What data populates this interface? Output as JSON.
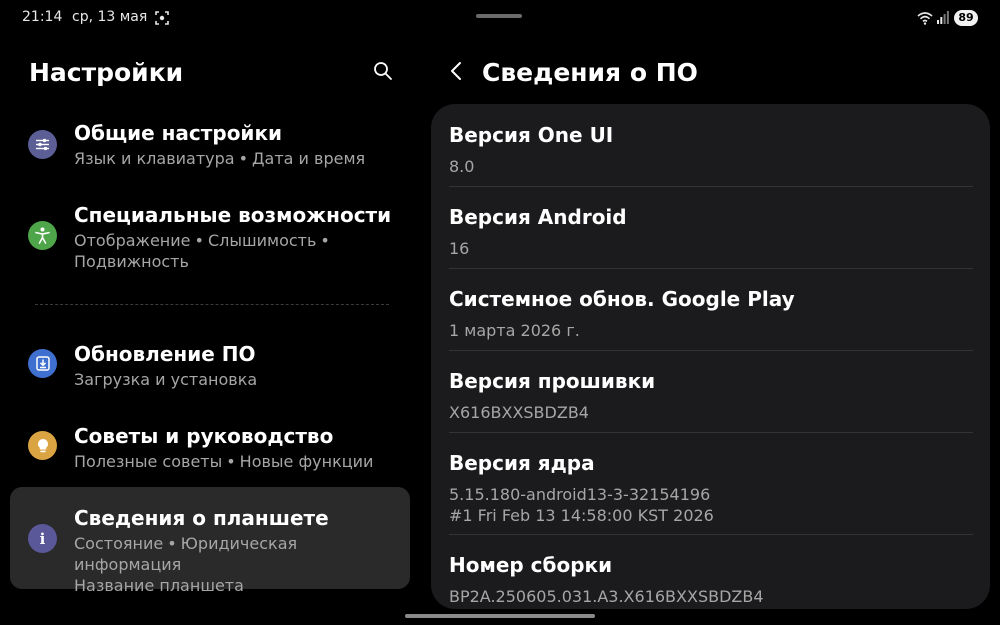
{
  "status_bar": {
    "time": "21:14",
    "date": "ср, 13 мая",
    "battery": "89",
    "icons": [
      "screenshot-icon",
      "wifi-icon",
      "signal-icon"
    ]
  },
  "left_pane": {
    "title": "Настройки",
    "items": [
      {
        "title": "Общие настройки",
        "subtitle_parts": [
          "Язык и клавиатура",
          "Дата и время"
        ],
        "icon": "sliders-icon",
        "icon_color": "#5b5f96"
      },
      {
        "title": "Специальные возможности",
        "subtitle_parts": [
          "Отображение",
          "Слышимость",
          "Подвижность"
        ],
        "icon": "accessibility-icon",
        "icon_color": "#4fa64a"
      },
      {
        "title": "Обновление ПО",
        "subtitle_parts": [
          "Загрузка и установка"
        ],
        "icon": "software-update-icon",
        "icon_color": "#3f6fcf"
      },
      {
        "title": "Советы и руководство",
        "subtitle_parts": [
          "Полезные советы",
          "Новые функции"
        ],
        "icon": "lightbulb-icon",
        "icon_color": "#d9a441"
      },
      {
        "title": "Сведения о планшете",
        "subtitle_parts": [
          "Состояние",
          "Юридическая информация",
          "Название планшета"
        ],
        "icon": "info-icon",
        "icon_color": "#5a5898",
        "selected": true
      }
    ]
  },
  "right_pane": {
    "title": "Сведения о ПО",
    "rows": [
      {
        "label": "Версия One UI",
        "value_lines": [
          "8.0"
        ]
      },
      {
        "label": "Версия Android",
        "value_lines": [
          "16"
        ]
      },
      {
        "label": "Системное обнов. Google Play",
        "value_lines": [
          "1 марта 2026 г."
        ]
      },
      {
        "label": "Версия прошивки",
        "value_lines": [
          "X616BXXSBDZB4"
        ]
      },
      {
        "label": "Версия ядра",
        "value_lines": [
          "5.15.180-android13-3-32154196",
          "#1 Fri Feb 13 14:58:00 KST 2026"
        ]
      },
      {
        "label": "Номер сборки",
        "value_lines": [
          "BP2A.250605.031.A3.X616BXXSBDZB4"
        ]
      }
    ]
  },
  "colors": {
    "background": "#000000",
    "card": "#1b1b1d",
    "selected_item": "#2a2a2a",
    "secondary_text": "#a6a6a6"
  }
}
